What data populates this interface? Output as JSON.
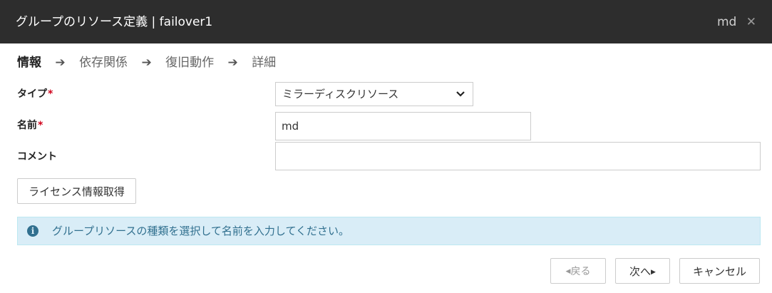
{
  "window": {
    "title": "グループのリソース定義 | failover1",
    "resource_name": "md",
    "close_symbol": "✕"
  },
  "steps": [
    {
      "label": "情報",
      "active": true
    },
    {
      "label": "依存関係",
      "active": false
    },
    {
      "label": "復旧動作",
      "active": false
    },
    {
      "label": "詳細",
      "active": false
    }
  ],
  "step_arrow": "➔",
  "form": {
    "type_label": "タイプ",
    "type_value": "ミラーディスクリソース",
    "name_label": "名前",
    "name_value": "md",
    "comment_label": "コメント",
    "comment_value": "",
    "required_mark": "*"
  },
  "license_button": "ライセンス情報取得",
  "alert": {
    "icon": "info-icon",
    "message": "グループリソースの種類を選択して名前を入力してください。"
  },
  "footer": {
    "back_label": "戻る",
    "next_label": "次へ",
    "cancel_label": "キャンセル",
    "back_enabled": false
  },
  "colors": {
    "titlebar": "#2d2d2d",
    "required": "#d0021b",
    "alert_bg": "#d9edf7",
    "alert_text": "#31708f"
  }
}
